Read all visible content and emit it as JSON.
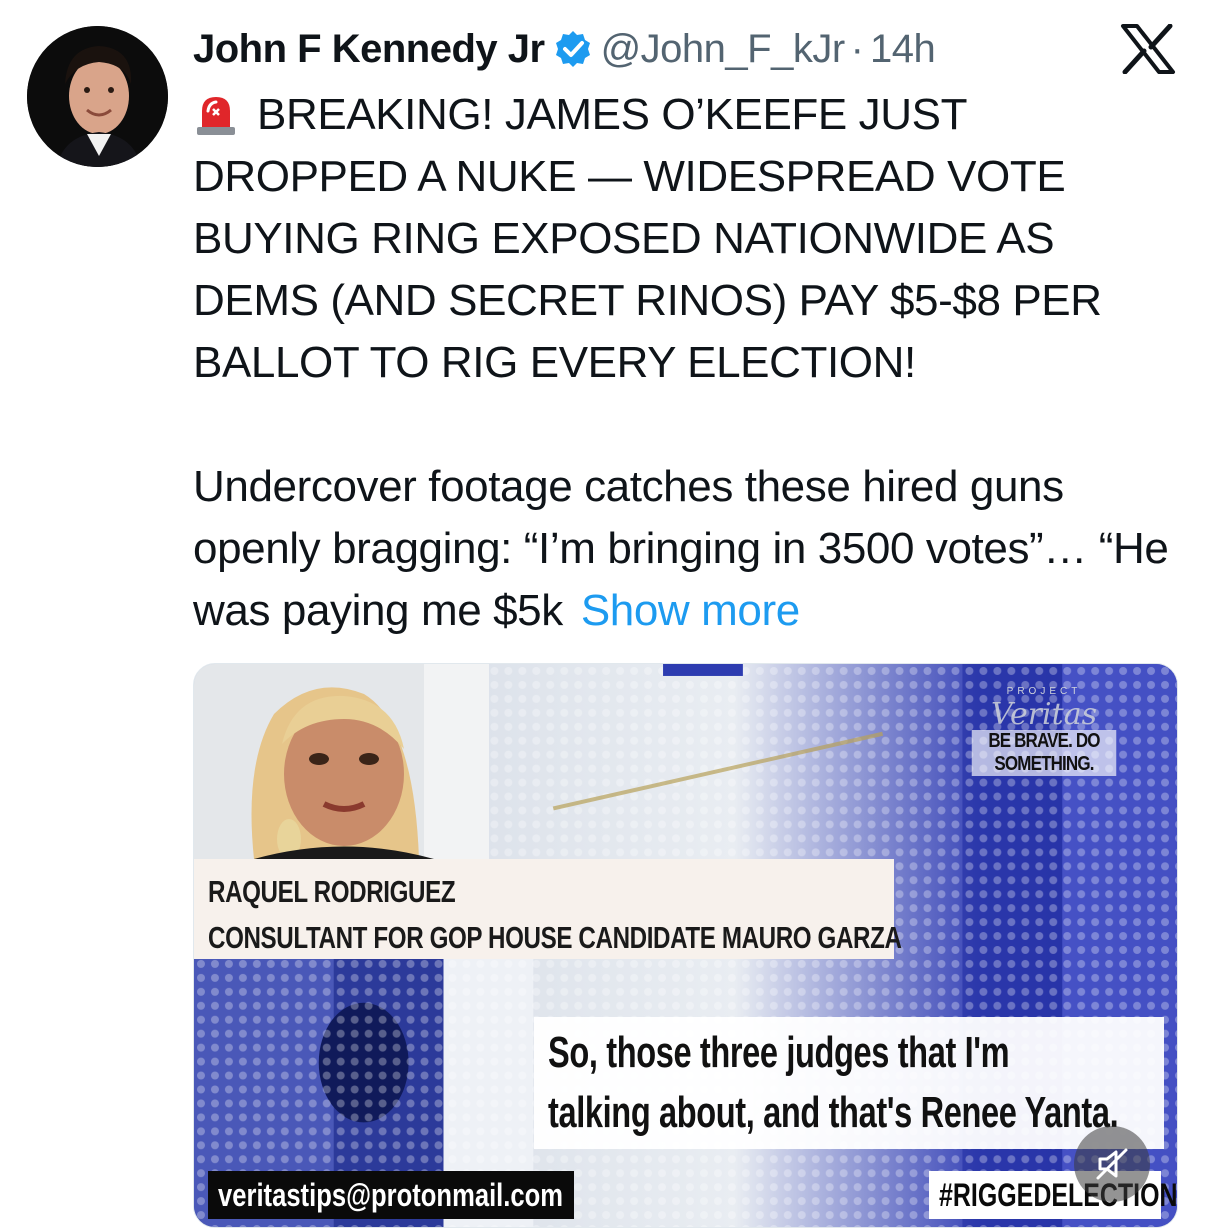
{
  "tweet": {
    "author": {
      "display_name": "John F Kennedy Jr",
      "handle": "@John_F_kJr",
      "verified": true,
      "avatar_icon": "profile-photo"
    },
    "separator": "·",
    "timestamp": "14h",
    "platform_icon": "x-logo-icon",
    "siren_icon": "rotating-light-emoji",
    "headline": "BREAKING! JAMES O’KEEFE JUST DROPPED A NUKE — WIDESPREAD VOTE BUYING RING EXPOSED NATIONWIDE AS DEMS (AND SECRET RINOS) PAY $5-$8 PER BALLOT TO RIG EVERY ELECTION!",
    "body": "Undercover footage catches these hired guns openly bragging: “I’m bringing in 3500 votes”… “He was paying me $5k",
    "show_more_label": "Show more",
    "colors": {
      "link": "#1d9bf0",
      "verified": "#1d9bf0",
      "secondary_text": "#536471"
    }
  },
  "media": {
    "logo_name": "Veritas",
    "logo_super": "PROJECT",
    "logo_tagline": "BE BRAVE. DO SOMETHING.",
    "lower_third": {
      "name": "RAQUEL RODRIGUEZ",
      "role": "CONSULTANT FOR GOP HOUSE CANDIDATE MAURO GARZA"
    },
    "caption_lines": [
      "So, those three judges that I'm",
      "talking about, and that's Renee Yanta."
    ],
    "email": "veritastips@protonmail.com",
    "hashtag": "#RIGGEDELECTION",
    "mute_icon": "muted-speaker-icon"
  }
}
